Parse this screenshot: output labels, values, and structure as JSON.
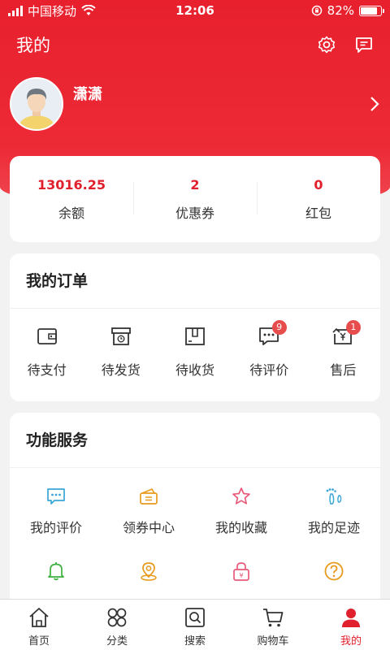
{
  "status_bar": {
    "carrier": "中国移动",
    "time": "12:06",
    "battery": "82%",
    "battery_level": 0.82
  },
  "header": {
    "title": "我的",
    "icons": [
      "settings-icon",
      "message-icon"
    ]
  },
  "profile": {
    "name": "潇潇"
  },
  "balance": [
    {
      "value": "13016.25",
      "label": "余额"
    },
    {
      "value": "2",
      "label": "优惠券"
    },
    {
      "value": "0",
      "label": "红包"
    }
  ],
  "orders": {
    "title": "我的订单",
    "items": [
      {
        "label": "待支付",
        "icon": "wallet-icon",
        "badge": ""
      },
      {
        "label": "待发货",
        "icon": "box-clock-icon",
        "badge": ""
      },
      {
        "label": "待收货",
        "icon": "package-icon",
        "badge": ""
      },
      {
        "label": "待评价",
        "icon": "comment-icon",
        "badge": "9"
      },
      {
        "label": "售后",
        "icon": "refund-icon",
        "badge": "1"
      }
    ]
  },
  "services": {
    "title": "功能服务",
    "items": [
      {
        "label": "我的评价",
        "icon": "comment-icon",
        "color": "#3aa7d8"
      },
      {
        "label": "领券中心",
        "icon": "coupon-icon",
        "color": "#e89a1c"
      },
      {
        "label": "我的收藏",
        "icon": "star-icon",
        "color": "#e85a7a"
      },
      {
        "label": "我的足迹",
        "icon": "footprint-icon",
        "color": "#3aa7d8"
      },
      {
        "label": "",
        "icon": "bell-icon",
        "color": "#3bb03b"
      },
      {
        "label": "",
        "icon": "location-icon",
        "color": "#e89a1c"
      },
      {
        "label": "",
        "icon": "lock-icon",
        "color": "#e85a7a"
      },
      {
        "label": "",
        "icon": "help-icon",
        "color": "#e89a1c"
      }
    ]
  },
  "tabbar": {
    "items": [
      {
        "label": "首页",
        "icon": "home-icon",
        "active": false
      },
      {
        "label": "分类",
        "icon": "category-icon",
        "active": false
      },
      {
        "label": "搜索",
        "icon": "search-icon",
        "active": false
      },
      {
        "label": "购物车",
        "icon": "cart-icon",
        "active": false
      },
      {
        "label": "我的",
        "icon": "user-icon",
        "active": true
      }
    ],
    "active_color": "#e0202c"
  }
}
